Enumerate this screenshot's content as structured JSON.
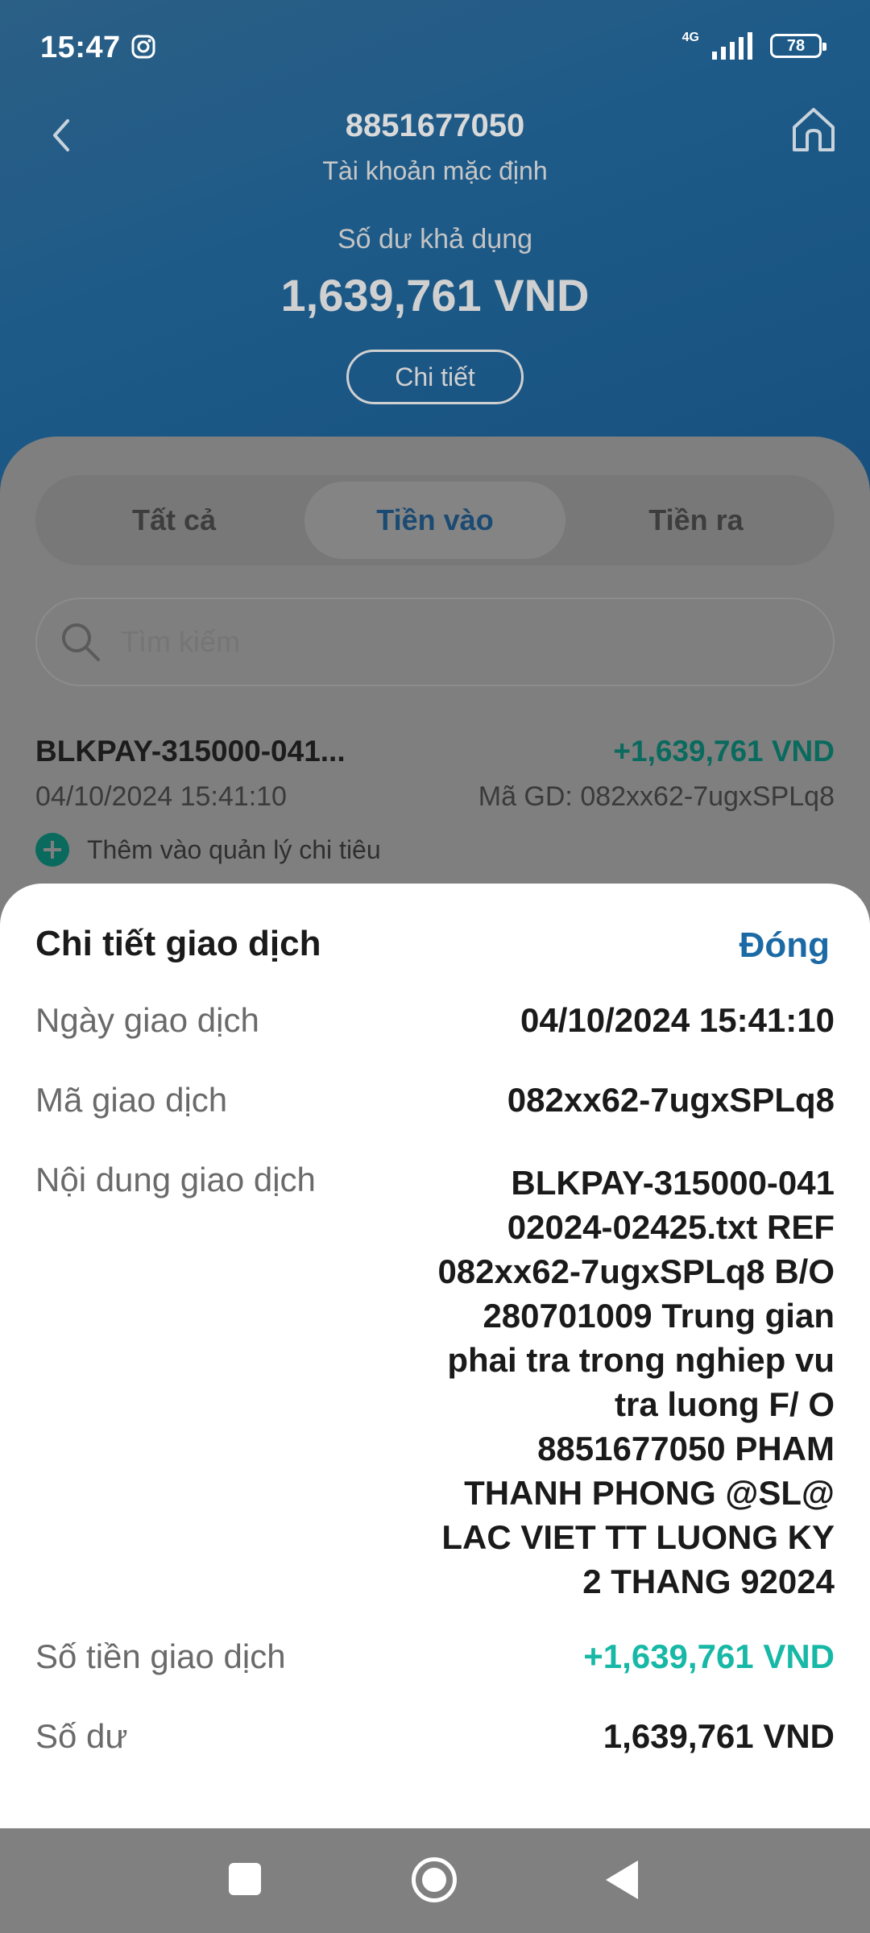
{
  "status_bar": {
    "time": "15:47",
    "network": "4G",
    "battery": "78"
  },
  "header": {
    "account_number": "8851677050",
    "account_label": "Tài khoản mặc định",
    "available_label": "Số dư khả dụng",
    "available_amount": "1,639,761 VND",
    "detail_button": "Chi tiết"
  },
  "tabs": [
    {
      "label": "Tất cả"
    },
    {
      "label": "Tiền vào"
    },
    {
      "label": "Tiền ra"
    }
  ],
  "search": {
    "placeholder": "Tìm kiếm"
  },
  "transaction": {
    "name": "BLKPAY-315000-041...",
    "amount": "+1,639,761 VND",
    "date": "04/10/2024 15:41:10",
    "code": "Mã GD: 082xx62-7ugxSPLq8",
    "add_label": "Thêm vào quản lý chi tiêu"
  },
  "sheet": {
    "title": "Chi tiết giao dịch",
    "close_label": "Đóng",
    "rows": [
      {
        "label": "Ngày giao dịch",
        "value": "04/10/2024 15:41:10"
      },
      {
        "label": "Mã giao dịch",
        "value": "082xx62-7ugxSPLq8"
      },
      {
        "label": "Nội dung giao dịch",
        "value": "BLKPAY-315000-041 02024-02425.txt REF 082xx62-7ugxSPLq8 B/O 280701009 Trung gian phai tra trong nghiep vu tra luong F/ O 8851677050 PHAM THANH PHONG @SL@ LAC VIET TT LUONG KY 2 THANG 92024"
      },
      {
        "label": "Số tiền giao dịch",
        "value": "+1,639,761 VND"
      },
      {
        "label": "Số dư",
        "value": "1,639,761 VND"
      }
    ]
  },
  "colors": {
    "header_blue": "#1d5a88",
    "accent_blue": "#1b6aa5",
    "positive_green": "#18b8a6"
  }
}
